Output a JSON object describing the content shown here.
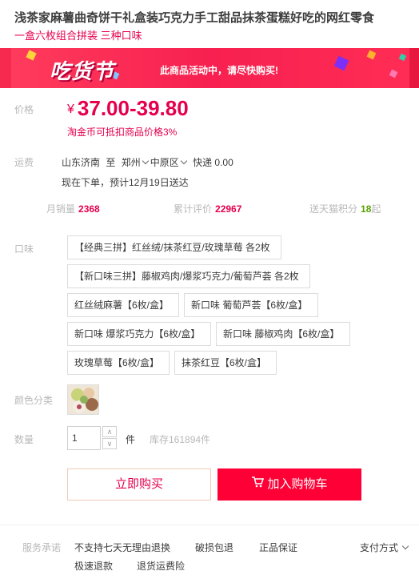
{
  "product": {
    "title": "浅茶家麻薯曲奇饼干礼盒装巧克力手工甜品抹茶蛋糕好吃的网红零食",
    "subtitle": "一盒六枚组合拼装 三种口味"
  },
  "banner": {
    "logo": "吃货节",
    "message": "此商品活动中，请尽快购买!"
  },
  "price": {
    "label": "价格",
    "currency": "¥",
    "range": "37.00-39.80",
    "coin_note": "淘金币可抵扣商品价格3%"
  },
  "shipping": {
    "label": "运费",
    "origin": "山东济南",
    "to": "至",
    "city": "郑州",
    "district": "中原区",
    "method": "快递 0.00",
    "eta": "现在下单，预计12月19日送达"
  },
  "stats": {
    "monthly_sales_label": "月销量",
    "monthly_sales": "2368",
    "reviews_label": "累计评价",
    "reviews": "22967",
    "points_label": "送天猫积分",
    "points": "18",
    "points_unit": "起"
  },
  "flavor": {
    "label": "口味",
    "options": [
      "【经典三拼】红丝绒/抹茶红豆/玫瑰草莓 各2枚",
      "【新口味三拼】藤椒鸡肉/爆浆巧克力/葡萄芦荟 各2枚",
      "红丝绒麻薯【6枚/盒】",
      "新口味 葡萄芦荟【6枚/盒】",
      "新口味 爆浆巧克力【6枚/盒】",
      "新口味 藤椒鸡肉【6枚/盒】",
      "玫瑰草莓【6枚/盒】",
      "抹茶红豆【6枚/盒】"
    ]
  },
  "color": {
    "label": "颜色分类"
  },
  "quantity": {
    "label": "数量",
    "value": "1",
    "unit": "件",
    "stock": "库存161894件"
  },
  "actions": {
    "buy_now": "立即购买",
    "add_to_cart": "加入购物车"
  },
  "service": {
    "label": "服务承诺",
    "items": [
      "不支持七天无理由退换",
      "破损包退",
      "正品保证",
      "极速退款",
      "退货运费险"
    ],
    "payment": "支付方式"
  },
  "colors": {
    "accent": "#e5004f",
    "cart": "#ff0036",
    "green": "#5aa000"
  }
}
